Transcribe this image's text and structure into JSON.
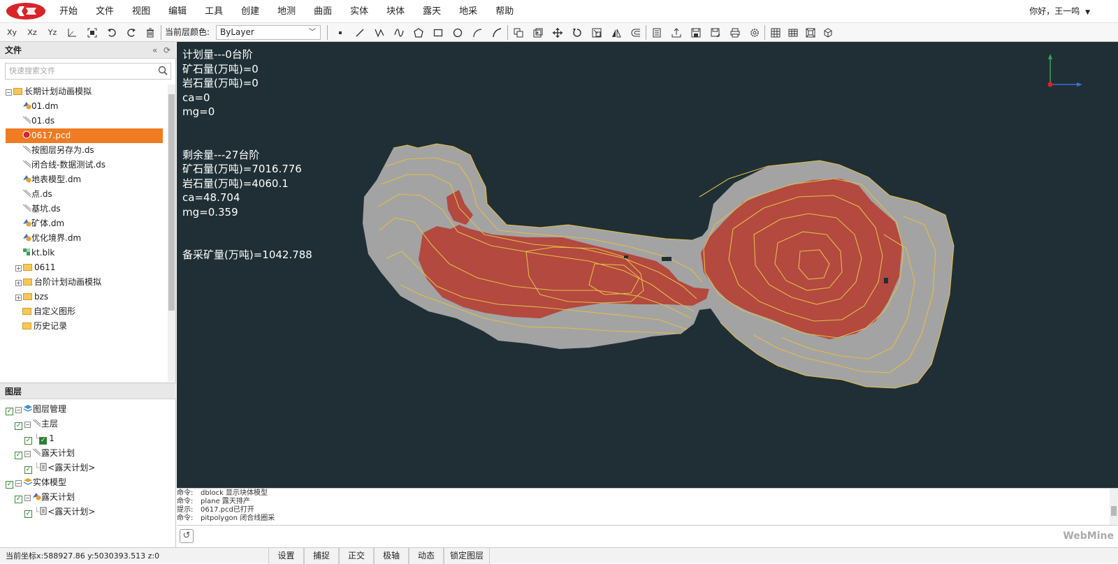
{
  "menu": {
    "items": [
      "开始",
      "文件",
      "视图",
      "编辑",
      "工具",
      "创建",
      "地测",
      "曲面",
      "实体",
      "块体",
      "露天",
      "地采",
      "帮助"
    ],
    "greeting": "你好，王一鸣"
  },
  "toolbar": {
    "axis_xy": "Xy",
    "axis_xz": "Xz",
    "axis_yz": "Yz",
    "layer_color_label": "当前层颜色:",
    "layer_color_value": "ByLayer"
  },
  "files_panel": {
    "title": "文件",
    "search_placeholder": "快速搜索文件",
    "items": [
      {
        "label": "长期计划动画模拟",
        "type": "folder",
        "expander": "−"
      },
      {
        "label": "01.dm",
        "type": "dm"
      },
      {
        "label": "01.ds",
        "type": "ds"
      },
      {
        "label": "0617.pcd",
        "type": "pcd"
      },
      {
        "label": "按图层另存为.ds",
        "type": "ds"
      },
      {
        "label": "闭合线-数据测试.ds",
        "type": "ds"
      },
      {
        "label": "地表模型.dm",
        "type": "dm"
      },
      {
        "label": "点.ds",
        "type": "ds"
      },
      {
        "label": "基坑.ds",
        "type": "ds"
      },
      {
        "label": "矿体.dm",
        "type": "dm"
      },
      {
        "label": "优化境界.dm",
        "type": "dm"
      },
      {
        "label": "kt.blk",
        "type": "blk"
      },
      {
        "label": "0611",
        "type": "folder",
        "expander": "+"
      },
      {
        "label": "台阶计划动画模拟",
        "type": "folder",
        "expander": "+"
      },
      {
        "label": "bzs",
        "type": "folder",
        "expander": "+"
      },
      {
        "label": "自定义图形",
        "type": "folder"
      },
      {
        "label": "历史记录",
        "type": "folder"
      }
    ]
  },
  "layers_panel": {
    "title": "图层",
    "items": [
      {
        "label": "图层管理"
      },
      {
        "label": "主层"
      },
      {
        "label": "1"
      },
      {
        "label": "露天计划"
      },
      {
        "label": "<露天计划>"
      },
      {
        "label": "实体模型"
      },
      {
        "label": "露天计划"
      },
      {
        "label": "<露天计划>"
      }
    ]
  },
  "viewport": {
    "stats": [
      "计划量---0台阶",
      "矿石量(万吨)=0",
      "岩石量(万吨)=0",
      "ca=0",
      "mg=0",
      "剩余量---27台阶",
      "矿石量(万吨)=7016.776",
      "岩石量(万吨)=4060.1",
      "ca=48.704",
      "mg=0.359",
      "备采矿量(万吨)=1042.788"
    ],
    "colors": {
      "background": "#1f2f35",
      "waste": "#a3a3a3",
      "ore": "#b3493f",
      "contour": "#e3bd47"
    }
  },
  "command_log": [
    {
      "k": "命令:",
      "v": "dblock 显示块体模型"
    },
    {
      "k": "命令:",
      "v": "plane 露天排产"
    },
    {
      "k": "提示:",
      "v": "0617.pcd已打开"
    },
    {
      "k": "命令:",
      "v": "pitpolygon 闭合线圈采"
    }
  ],
  "brand": "WebMine",
  "status": {
    "coords": "当前坐标x:588927.86    y:5030393.513    z:0",
    "buttons": [
      "设置",
      "捕捉",
      "正交",
      "极轴",
      "动态",
      "锁定图层"
    ]
  }
}
